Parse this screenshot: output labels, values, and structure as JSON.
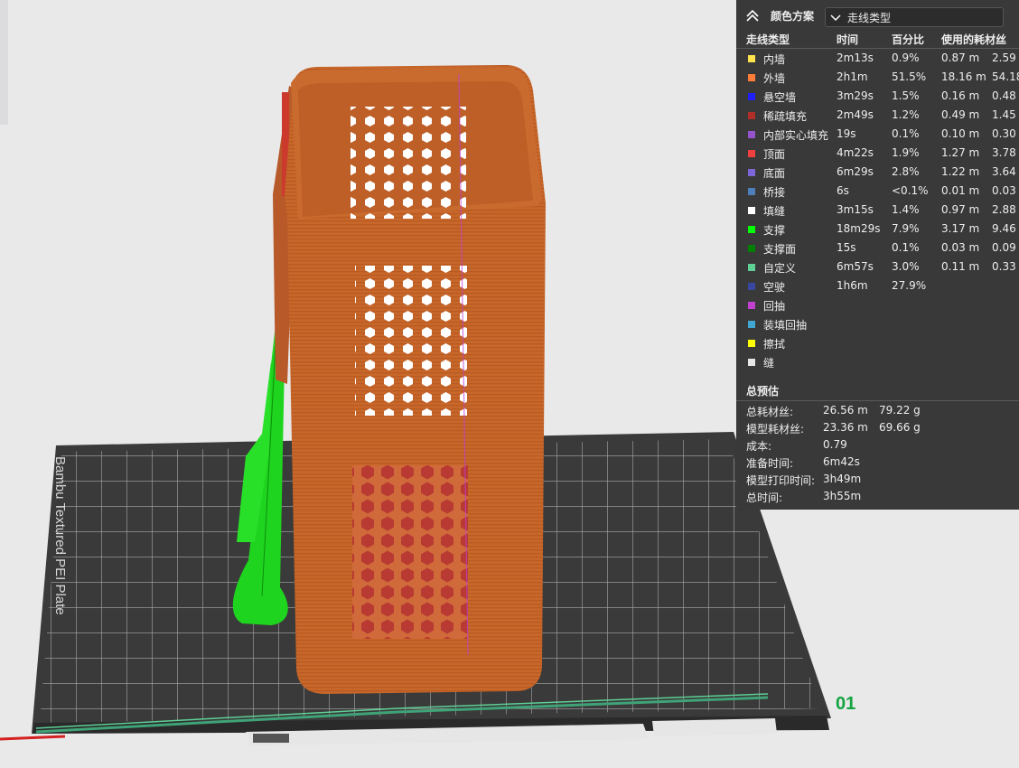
{
  "legend": {
    "title": "颜色方案",
    "scheme_value": "走线类型",
    "headers": {
      "type": "走线类型",
      "time": "时间",
      "percent": "百分比",
      "filament": "使用的耗材丝"
    },
    "rows": [
      {
        "name": "内墙",
        "color": "#ffe34d",
        "time": "2m13s",
        "percent": "0.9%",
        "length": "0.87 m",
        "weight": "2.59"
      },
      {
        "name": "外墙",
        "color": "#ff7d38",
        "time": "2h1m",
        "percent": "51.5%",
        "length": "18.16 m",
        "weight": "54.18"
      },
      {
        "name": "悬空墙",
        "color": "#1f1fff",
        "time": "3m29s",
        "percent": "1.5%",
        "length": "0.16 m",
        "weight": "0.48"
      },
      {
        "name": "稀疏填充",
        "color": "#b03029",
        "time": "2m49s",
        "percent": "1.2%",
        "length": "0.49 m",
        "weight": "1.45"
      },
      {
        "name": "内部实心填充",
        "color": "#9654cc",
        "time": "19s",
        "percent": "0.1%",
        "length": "0.10 m",
        "weight": "0.30"
      },
      {
        "name": "顶面",
        "color": "#f04040",
        "time": "4m22s",
        "percent": "1.9%",
        "length": "1.27 m",
        "weight": "3.78"
      },
      {
        "name": "底面",
        "color": "#7d67d8",
        "time": "6m29s",
        "percent": "2.8%",
        "length": "1.22 m",
        "weight": "3.64"
      },
      {
        "name": "桥接",
        "color": "#4d80ba",
        "time": "6s",
        "percent": "<0.1%",
        "length": "0.01 m",
        "weight": "0.03"
      },
      {
        "name": "填缝",
        "color": "#ffffff",
        "time": "3m15s",
        "percent": "1.4%",
        "length": "0.97 m",
        "weight": "2.88"
      },
      {
        "name": "支撑",
        "color": "#00ff00",
        "time": "18m29s",
        "percent": "7.9%",
        "length": "3.17 m",
        "weight": "9.46"
      },
      {
        "name": "支撑面",
        "color": "#008000",
        "time": "15s",
        "percent": "0.1%",
        "length": "0.03 m",
        "weight": "0.09"
      },
      {
        "name": "自定义",
        "color": "#5ed096",
        "time": "6m57s",
        "percent": "3.0%",
        "length": "0.11 m",
        "weight": "0.33"
      },
      {
        "name": "空驶",
        "color": "#3848a0",
        "time": "1h6m",
        "percent": "27.9%",
        "length": "",
        "weight": ""
      },
      {
        "name": "回抽",
        "color": "#c040d0",
        "time": "",
        "percent": "",
        "length": "",
        "weight": ""
      },
      {
        "name": "装填回抽",
        "color": "#40a8d0",
        "time": "",
        "percent": "",
        "length": "",
        "weight": ""
      },
      {
        "name": "擦拭",
        "color": "#ffff00",
        "time": "",
        "percent": "",
        "length": "",
        "weight": ""
      },
      {
        "name": "缝",
        "color": "#e6e6e6",
        "time": "",
        "percent": "",
        "length": "",
        "weight": ""
      }
    ]
  },
  "summary": {
    "title": "总预估",
    "rows": [
      {
        "label": "总耗材丝:",
        "v1": "26.56 m",
        "v2": "79.22 g"
      },
      {
        "label": "模型耗材丝:",
        "v1": "23.36 m",
        "v2": "69.66 g"
      },
      {
        "label": "成本:",
        "v1": "0.79",
        "v2": ""
      },
      {
        "label": "准备时间:",
        "v1": "6m42s",
        "v2": ""
      },
      {
        "label": "模型打印时间:",
        "v1": "3h49m",
        "v2": ""
      },
      {
        "label": "总时间:",
        "v1": "3h55m",
        "v2": ""
      }
    ]
  },
  "plate": {
    "number": "01",
    "bed_text": "Bambu Textured PEI Plate",
    "colors": {
      "bed": "#3b3b3b",
      "grid": "#b8b8b8",
      "model": "#c8672a",
      "support": "#22cc22",
      "infill": "#b83a32"
    }
  }
}
